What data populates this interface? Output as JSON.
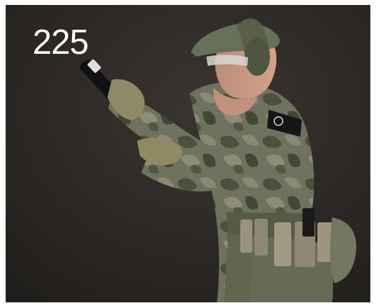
{
  "image": {
    "label": "225",
    "colors": {
      "frame": "#ffffff",
      "backdrop": "#2f2b28",
      "camo_base": "#6f725e",
      "camo_dark": "#424834",
      "camo_light": "#8d8c79",
      "pouch": "#8f8775",
      "pistol": "#111111",
      "text": "#ffffff"
    }
  }
}
